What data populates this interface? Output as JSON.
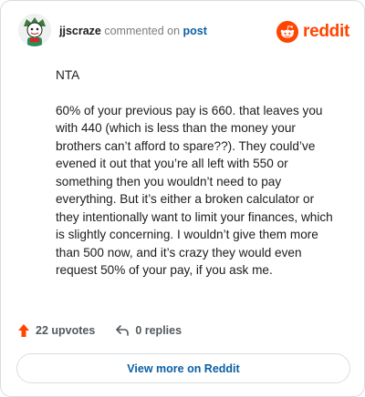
{
  "header": {
    "username": "jjscraze",
    "action_text": "commented on",
    "post_link": "post",
    "brand": "reddit"
  },
  "comment": {
    "paragraphs": [
      "NTA",
      "60% of your previous pay is 660. that leaves you with 440 (which is less than the money your brothers can’t afford to spare??). They could’ve evened it out that you’re all left with 550 or something then you wouldn’t need to pay everything. But it’s either a broken calculator or they intentionally want to limit your finances, which is slightly concerning. I wouldn’t give them more than 500 now, and it’s crazy they would even request 50% of your pay, if you ask me."
    ]
  },
  "actions": {
    "upvotes": "22 upvotes",
    "replies": "0 replies"
  },
  "footer": {
    "view_more": "View more on Reddit"
  },
  "colors": {
    "brand": "#ff4500",
    "link": "#0a5fa6",
    "muted": "#7c7c7c"
  }
}
